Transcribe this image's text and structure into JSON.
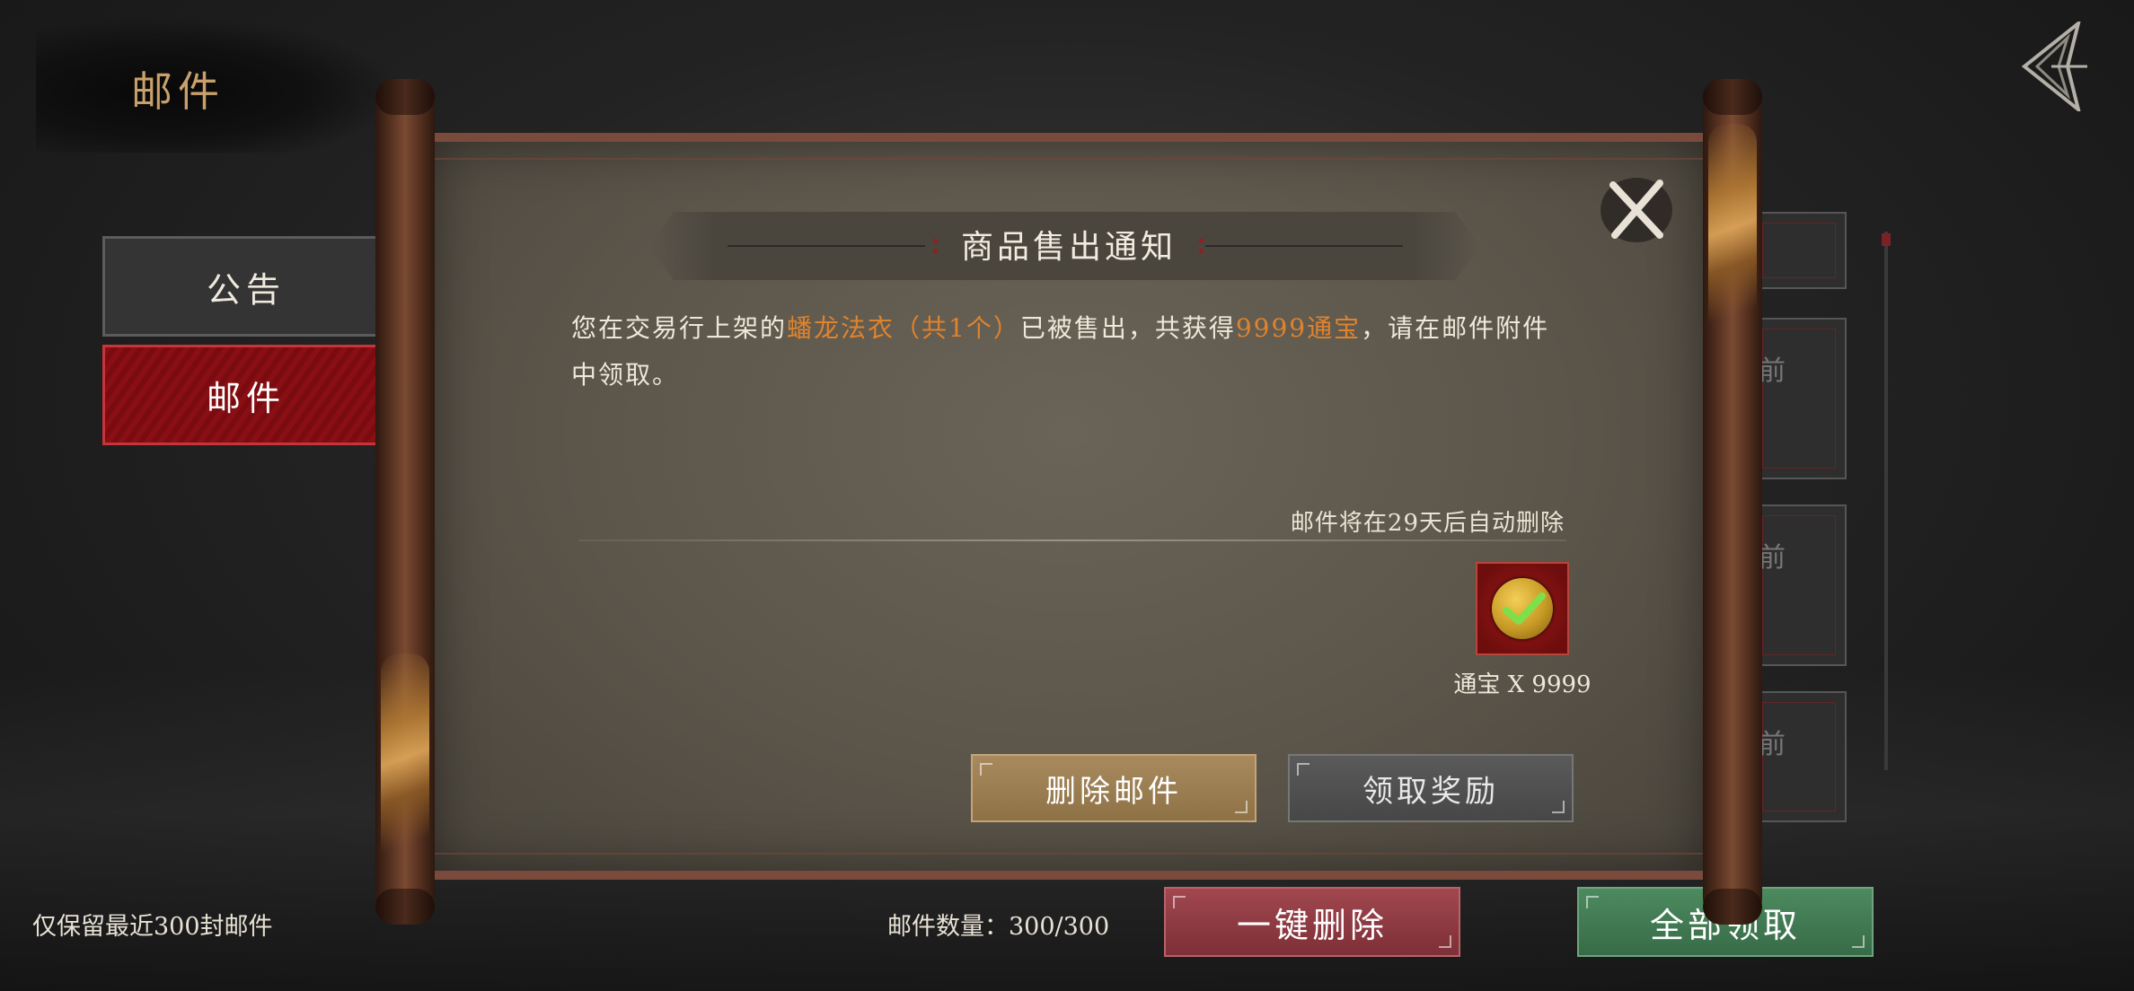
{
  "header": {
    "title": "邮件",
    "back_icon": "back-arrow-icon"
  },
  "sidebar": {
    "tabs": [
      {
        "label": "公告",
        "selected": false
      },
      {
        "label": "邮件",
        "selected": true
      }
    ]
  },
  "mail_list": {
    "partial_label": "前"
  },
  "mail_detail": {
    "title": "商品售出通知",
    "body": {
      "part1": "您在交易行上架的",
      "item_name": "蟠龙法衣（共1个）",
      "part2": "已被售出，共获得",
      "amount": "9999通宝",
      "part3": "，请在邮件附件中领取。"
    },
    "expire_text": "邮件将在29天后自动删除",
    "attachment": {
      "icon": "coin-icon",
      "label": "通宝 X 9999",
      "claimed": true
    },
    "delete_label": "删除邮件",
    "claim_label": "领取奖励"
  },
  "footer": {
    "retention_note": "仅保留最近300封邮件",
    "count_text": "邮件数量：300/300",
    "delete_all_label": "一键删除",
    "claim_all_label": "全部领取"
  },
  "colors": {
    "accent_gold": "#c9a06a",
    "highlight_orange": "#e0832d",
    "selected_tab_red": "#8a0f14",
    "delete_all_red": "#9b4049",
    "claim_all_green": "#4a8759"
  }
}
